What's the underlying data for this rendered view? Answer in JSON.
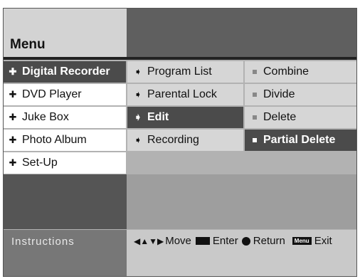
{
  "title": "Menu",
  "menu_level1": [
    {
      "label": "Digital Recorder",
      "selected": true
    },
    {
      "label": "DVD Player",
      "selected": false
    },
    {
      "label": "Juke Box",
      "selected": false
    },
    {
      "label": "Photo Album",
      "selected": false
    },
    {
      "label": "Set-Up",
      "selected": false
    }
  ],
  "menu_level2": [
    {
      "label": "Program List",
      "selected": false
    },
    {
      "label": "Parental Lock",
      "selected": false
    },
    {
      "label": "Edit",
      "selected": true
    },
    {
      "label": "Recording",
      "selected": false
    }
  ],
  "menu_level3": [
    {
      "label": "Combine",
      "selected": false
    },
    {
      "label": "Divide",
      "selected": false
    },
    {
      "label": "Delete",
      "selected": false
    },
    {
      "label": "Partial Delete",
      "selected": true
    }
  ],
  "instructions": {
    "label": "Instructions",
    "move": "Move",
    "enter": "Enter",
    "return": "Return",
    "menu_key": "Menu",
    "exit": "Exit"
  },
  "icons": {
    "level1": "cross-bullet-icon",
    "level2": "arrow-bullet-icon",
    "level3": "square-bullet-icon"
  }
}
